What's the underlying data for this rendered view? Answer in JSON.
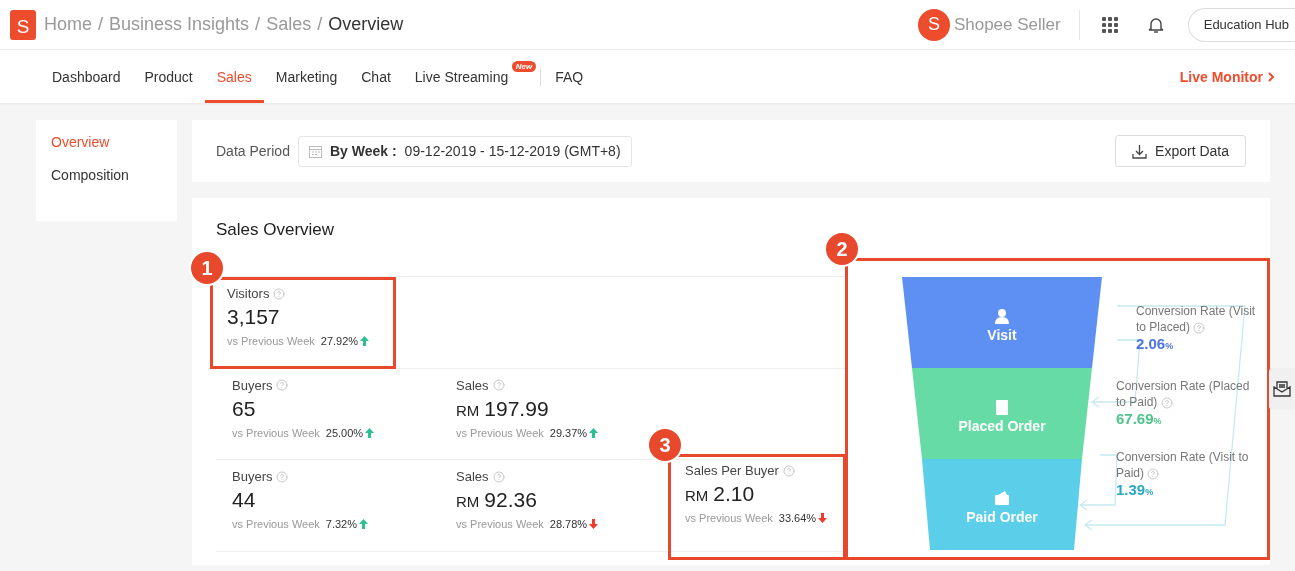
{
  "header": {
    "logo_letter": "S",
    "breadcrumb": [
      "Home",
      "Business Insights",
      "Sales",
      "Overview"
    ],
    "separator": "/",
    "brand_letter": "S",
    "brand_name": "Shopee Seller",
    "hub_button": "Education Hub"
  },
  "tabs": [
    {
      "label": "Dashboard",
      "selected": false
    },
    {
      "label": "Product",
      "selected": false
    },
    {
      "label": "Sales",
      "selected": true
    },
    {
      "label": "Marketing",
      "selected": false
    },
    {
      "label": "Chat",
      "selected": false
    },
    {
      "label": "Live Streaming",
      "selected": false,
      "badge": "New"
    },
    {
      "label": "FAQ",
      "selected": false,
      "divider_before": true
    }
  ],
  "live_monitor": "Live Monitor",
  "sidebar": {
    "items": [
      {
        "label": "Overview",
        "selected": true
      },
      {
        "label": "Composition",
        "selected": false
      }
    ]
  },
  "data_period": {
    "label": "Data Period",
    "mode": "By Week :",
    "range": "09-12-2019 - 15-12-2019 (GMT+8)"
  },
  "export_button": "Export Data",
  "overview": {
    "title": "Sales Overview",
    "rows": [
      [
        {
          "label": "Visitors",
          "value": "3,157",
          "compare": "vs Previous Week",
          "change": "27.92%",
          "increase": true,
          "annotation": "1"
        }
      ],
      [
        {
          "label": "Buyers",
          "value": "65",
          "compare": "vs Previous Week",
          "change": "25.00%",
          "increase": true
        },
        {
          "label": "Sales",
          "currency": "RM",
          "value": "197.99",
          "compare": "vs Previous Week",
          "change": "29.37%",
          "increase": true
        }
      ],
      [
        {
          "label": "Buyers",
          "value": "44",
          "compare": "vs Previous Week",
          "change": "7.32%",
          "increase": true
        },
        {
          "label": "Sales",
          "currency": "RM",
          "value": "92.36",
          "compare": "vs Previous Week",
          "change": "28.78%",
          "increase": false
        },
        {
          "label": "Sales Per Buyer",
          "currency": "RM",
          "value": "2.10",
          "compare": "vs Previous Week",
          "change": "33.64%",
          "increase": false,
          "annotation": "3"
        }
      ]
    ],
    "funnel": {
      "annotation": "2",
      "stages": [
        {
          "label": "Visit",
          "kind": "person",
          "color": "#5e8ff2"
        },
        {
          "label": "Placed Order",
          "kind": "document",
          "color": "#67dba6"
        },
        {
          "label": "Paid Order",
          "kind": "wallet",
          "color": "#5bcfea"
        }
      ],
      "rates": [
        {
          "label": "Conversion Rate (Visit to Placed)",
          "value": "2.06",
          "unit": "%",
          "color": "#4b74e2"
        },
        {
          "label": "Conversion Rate (Placed to Paid)",
          "value": "67.69",
          "unit": "%",
          "color": "#4cc48a"
        },
        {
          "label": "Conversion Rate (Visit to Paid)",
          "value": "1.39",
          "unit": "%",
          "color": "#2aa7c8"
        }
      ]
    }
  }
}
